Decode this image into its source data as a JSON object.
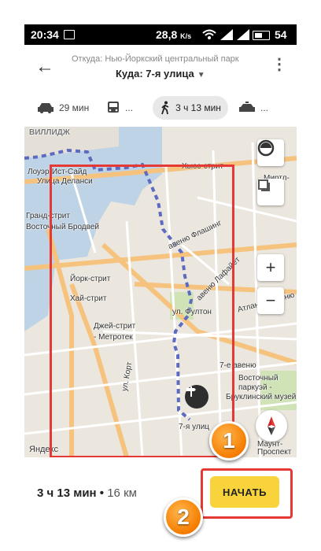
{
  "status_bar": {
    "time": "20:34",
    "speed": "28,8",
    "speed_unit": "K/s",
    "battery": "54"
  },
  "header": {
    "from": "Откуда: Нью-Йоркский центральный парк",
    "to": "Куда: 7-я улица",
    "caret": "▼",
    "back_icon": "arrow-left-icon",
    "menu_icon": "kebab-icon"
  },
  "modes": [
    {
      "name": "car",
      "label": "29 мин",
      "icon": "car-icon"
    },
    {
      "name": "bus",
      "label": "...",
      "icon": "bus-icon"
    },
    {
      "name": "walk",
      "label": "3 ч 13 мин",
      "icon": "walk-icon",
      "selected": true
    },
    {
      "name": "taxi",
      "label": "...",
      "icon": "taxi-icon"
    }
  ],
  "map": {
    "labels": {
      "villidzh": "ВИЛЛИДЖ",
      "lower_east": "Лоуэр-Ист-Сайд",
      "delancey": "Улица Деланси",
      "grand": "Гранд-стрит",
      "bowery": "Восточный Бродвей",
      "york": "Йорк-стрит",
      "high": "Хай-стрит",
      "jay": "Джей-стрит",
      "metrotech": "- Метротек",
      "court": "ул. Корт",
      "fulton": "ул. Фултон",
      "flushing": "авеню Флашинг",
      "lafayette": "авеню Лафайет",
      "atlantic": "Атлантик авеню",
      "hughes": "Хьюс-стрит",
      "myrtle": "Миртл-",
      "seventh_ave": "7-е авеню",
      "parkway1": "Восточный",
      "parkway2": "паркуэй -",
      "parkway3": "Бруклинский музей",
      "seventh_st": "7-я улиц",
      "mount1": "Маунт-",
      "mount2": "Проспект",
      "yandex": "Яндекс"
    },
    "zoom_in": "+",
    "zoom_out": "−",
    "route_color": "#5c6bc0"
  },
  "markers": {
    "one": "1",
    "two": "2"
  },
  "bottom": {
    "duration": "3 ч 13 мин",
    "sep": " • ",
    "distance": "16 км",
    "start_label": "НАЧАТЬ"
  },
  "colors": {
    "start_button": "#f9d33b",
    "highlight": "#e53935",
    "badge": "#f57c00"
  }
}
